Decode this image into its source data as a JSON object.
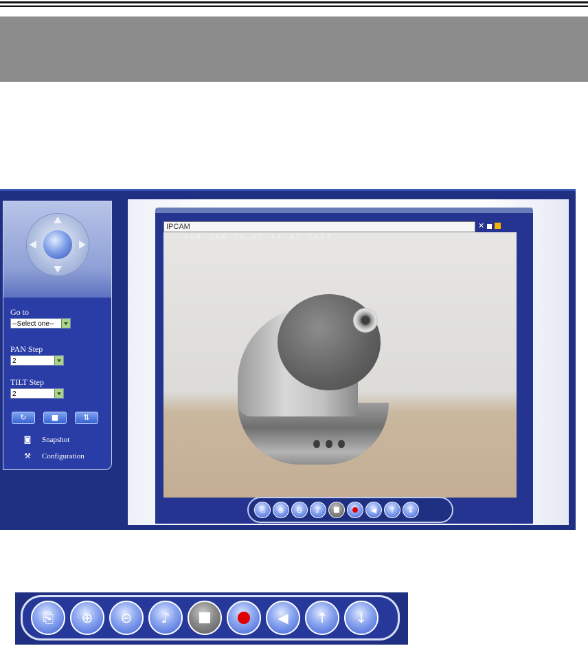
{
  "left_panel": {
    "goto_label": "Go to",
    "goto_value": "--Select one--",
    "pan_label": "PAN Step",
    "pan_value": "2",
    "tilt_label": "TILT Step",
    "tilt_value": "2",
    "snapshot_label": "Snapshot",
    "configuration_label": "Configuration"
  },
  "video": {
    "camera_name": "IPCAM",
    "timestamp": "SUN JAN 28 02:47:42 2007"
  },
  "toolbar_icons": [
    "snapshot-document-icon",
    "zoom-in-icon",
    "zoom-out-icon",
    "microphone-icon",
    "stop-icon",
    "record-icon",
    "speaker-icon",
    "volume-up-icon",
    "volume-down-icon"
  ],
  "colors": {
    "panel_blue": "#1f2f82",
    "header_grey": "#8c8c8c",
    "record_red": "#e00000"
  }
}
